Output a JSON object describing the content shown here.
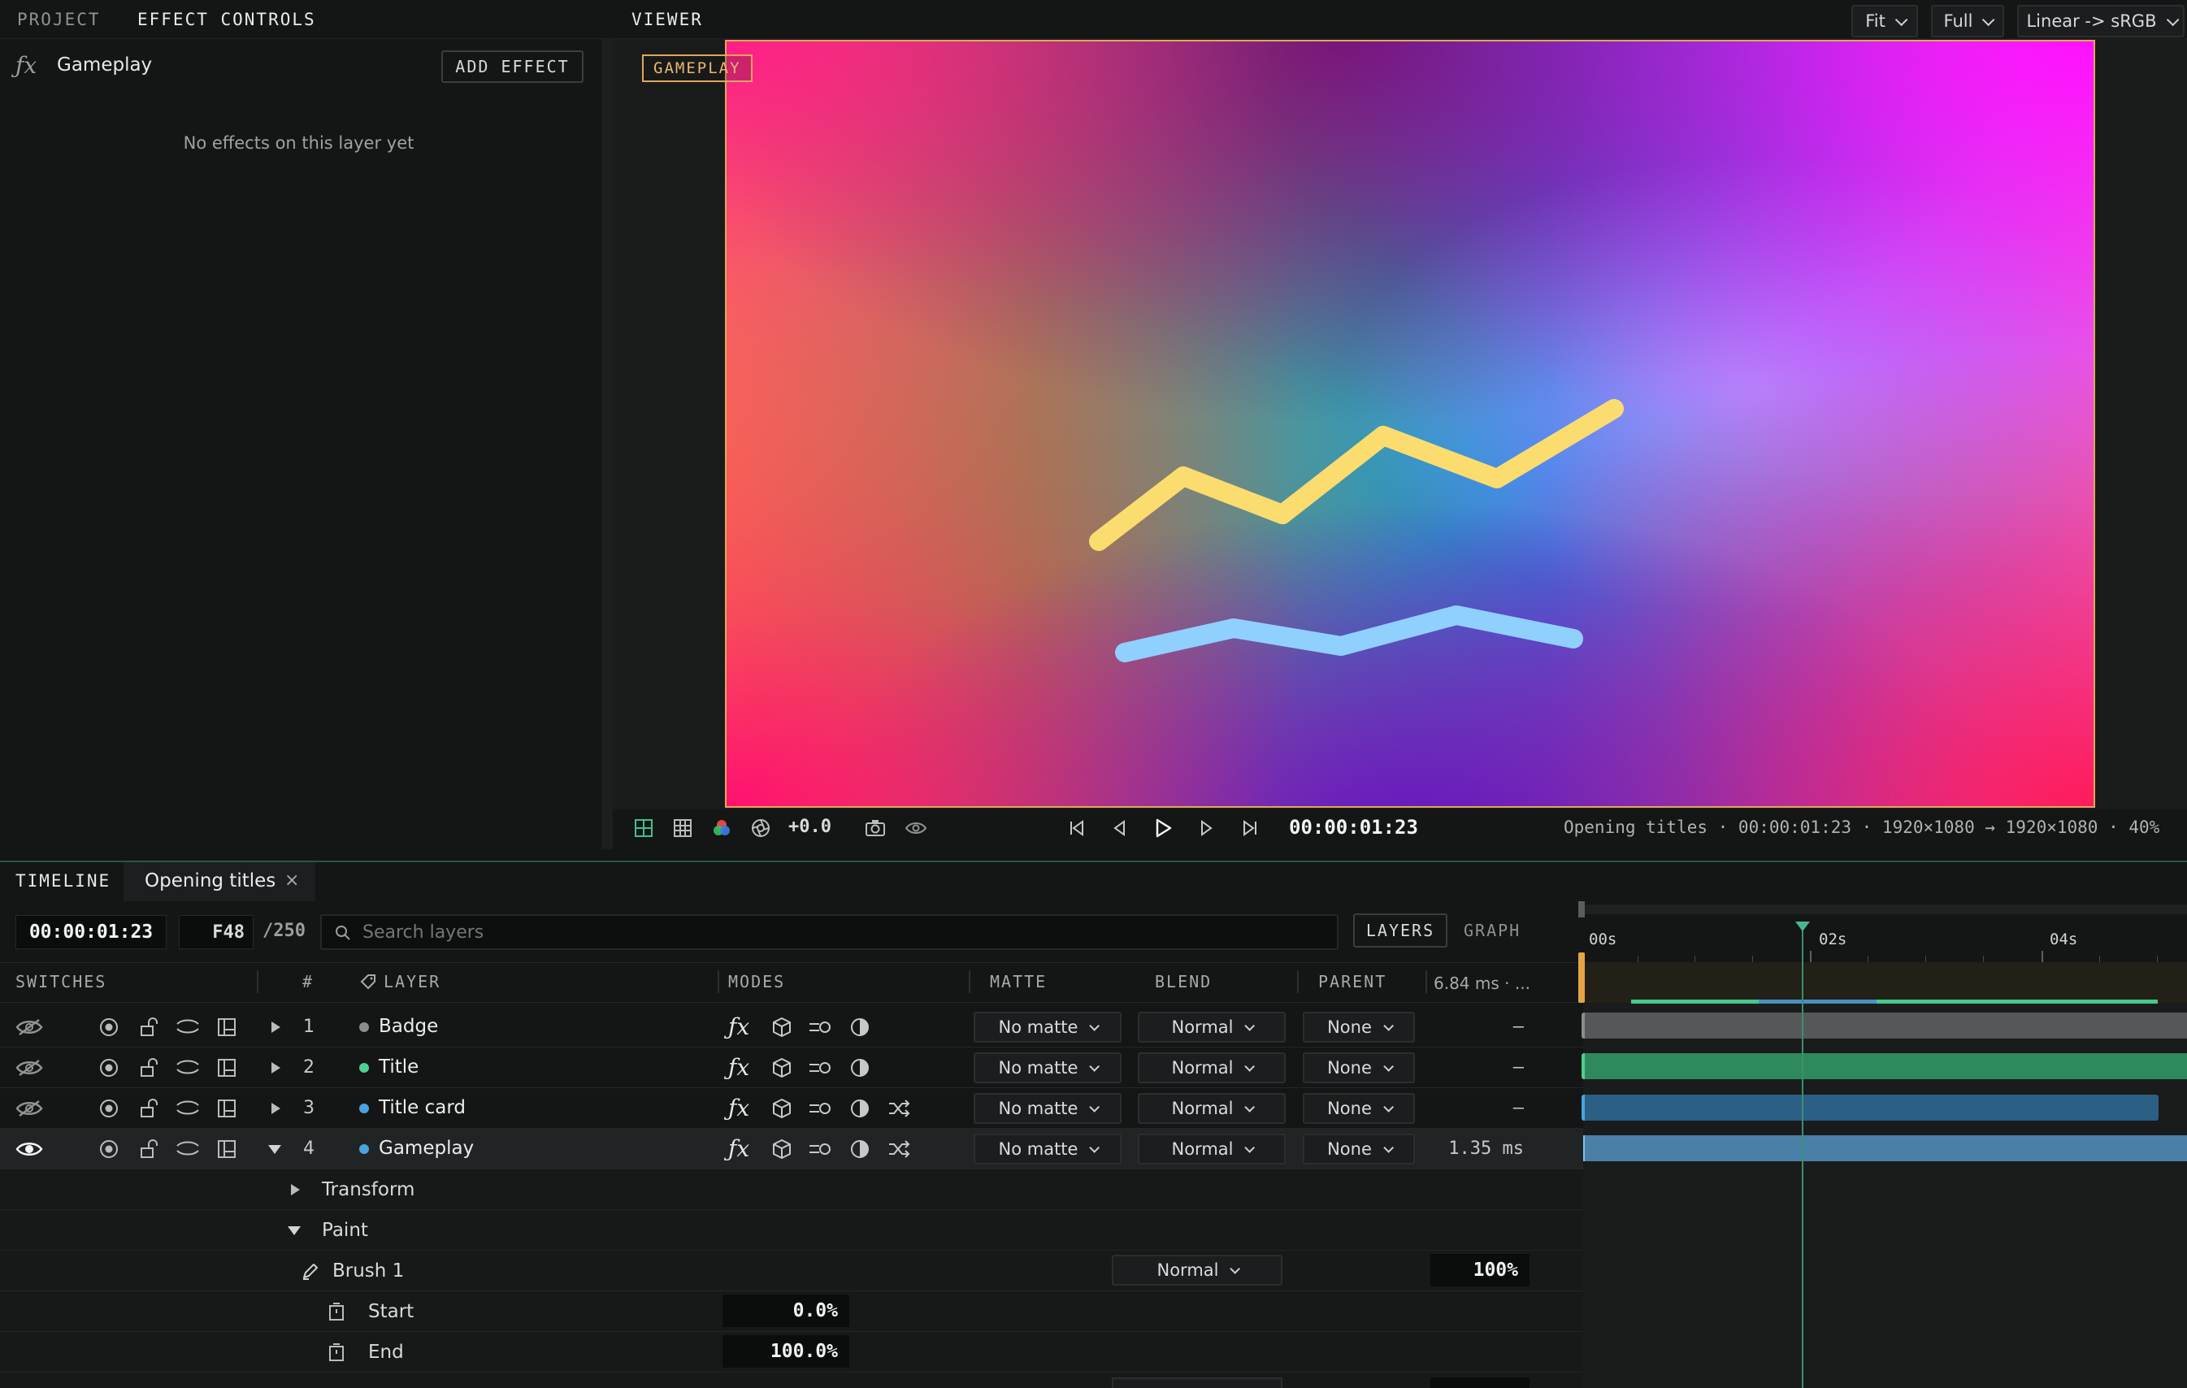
{
  "panels": {
    "project_tab": "PROJECT",
    "effect_controls_tab": "EFFECT CONTROLS",
    "viewer_tab": "VIEWER"
  },
  "effect_controls": {
    "layer_name": "Gameplay",
    "add_effect_label": "ADD EFFECT",
    "empty_message": "No effects on this layer yet"
  },
  "viewer": {
    "fit_label": "Fit",
    "full_label": "Full",
    "colorspace_label": "Linear -> sRGB",
    "layer_badge": "GAMEPLAY",
    "exposure": "+0.0",
    "timecode": "00:00:01:23",
    "status": "Opening titles · 00:00:01:23 · 1920×1080 → 1920×1080 · 40%"
  },
  "timeline": {
    "tab_label": "TIMELINE",
    "comp_tab": "Opening titles",
    "close_glyph": "×",
    "timecode": "00:00:01:23",
    "frame": "F48",
    "frame_total": "/250",
    "search_placeholder": "Search layers",
    "layers_btn": "LAYERS",
    "graph_btn": "GRAPH",
    "ruler": [
      "00s",
      "02s",
      "04s"
    ],
    "headers": {
      "switches": "SWITCHES",
      "num": "#",
      "layer": "LAYER",
      "modes": "MODES",
      "matte": "MATTE",
      "blend": "BLEND",
      "parent": "PARENT",
      "perf": "6.84 ms · ..."
    },
    "layers": [
      {
        "num": "1",
        "name": "Badge",
        "matte": "No matte",
        "blend": "Normal",
        "parent": "None",
        "perf": "–",
        "color": "#8a8d8e"
      },
      {
        "num": "2",
        "name": "Title",
        "matte": "No matte",
        "blend": "Normal",
        "parent": "None",
        "perf": "–",
        "color": "#4fd08e"
      },
      {
        "num": "3",
        "name": "Title card",
        "matte": "No matte",
        "blend": "Normal",
        "parent": "None",
        "perf": "–",
        "color": "#4aa3e0"
      },
      {
        "num": "4",
        "name": "Gameplay",
        "matte": "No matte",
        "blend": "Normal",
        "parent": "None",
        "perf": "1.35 ms",
        "color": "#4aa3e0"
      }
    ],
    "sub": {
      "transform": "Transform",
      "paint": "Paint",
      "brush": "Brush 1",
      "brush_blend": "Normal",
      "brush_opacity": "100%",
      "start_label": "Start",
      "start_value": "0.0%",
      "end_label": "End",
      "end_value": "100.0%"
    }
  }
}
